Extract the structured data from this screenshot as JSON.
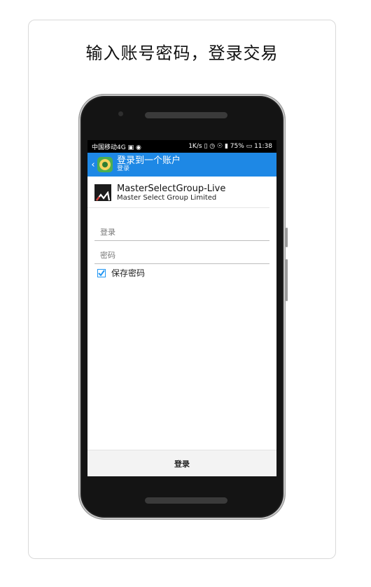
{
  "headline": "输入账号密码，登录交易",
  "status": {
    "carrier": "中国移动4G",
    "speed": "1K/s",
    "battery": "75%",
    "time": "11:38"
  },
  "appbar": {
    "title": "登录到一个账户",
    "subtitle": "登录"
  },
  "server": {
    "name": "MasterSelectGroup-Live",
    "company": "Master Select Group Limited"
  },
  "form": {
    "login_placeholder": "登录",
    "password_placeholder": "密码",
    "save_password_label": "保存密码",
    "save_password_checked": true
  },
  "footer": {
    "login_button": "登录"
  }
}
